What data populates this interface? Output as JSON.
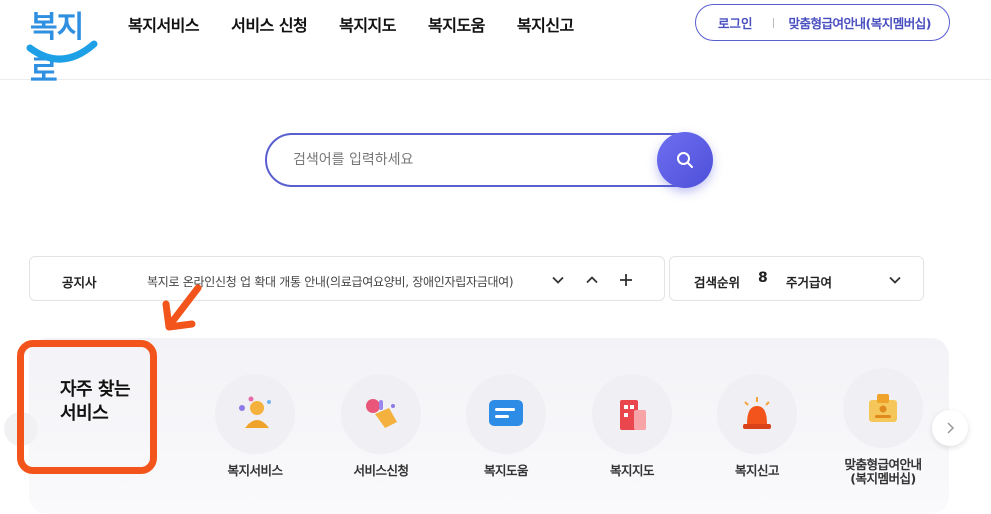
{
  "header": {
    "logo_text": "복지로",
    "nav": [
      "복지서비스",
      "서비스 신청",
      "복지지도",
      "복지도움",
      "복지신고"
    ],
    "login_label": "로그인",
    "membership_label": "맞춤형급여안내(복지멤버십)"
  },
  "search": {
    "placeholder": "검색어를 입력하세요"
  },
  "notice": {
    "label": "공지사",
    "text": "복지로 온라인신청 업 확대 개통 안내(의료급여요양비, 장애인자립자금대여)"
  },
  "rank": {
    "label": "검색순위",
    "number": "8",
    "term": "주거급여"
  },
  "frequent": {
    "title_line1": "자주 찾는",
    "title_line2": "서비스",
    "items": [
      {
        "label": "복지서비스",
        "icon": "people-icon"
      },
      {
        "label": "서비스신청",
        "icon": "hand-click-icon"
      },
      {
        "label": "복지도움",
        "icon": "chat-bubble-icon"
      },
      {
        "label": "복지지도",
        "icon": "building-icon"
      },
      {
        "label": "복지신고",
        "icon": "siren-icon"
      },
      {
        "label_line1": "맞춤형급여안내",
        "label_line2": "(복지멤버십)",
        "icon": "id-card-icon"
      }
    ]
  },
  "colors": {
    "accent": "#5a5fd0",
    "logo": "#2f8fe0",
    "annotation": "#f2541b"
  }
}
